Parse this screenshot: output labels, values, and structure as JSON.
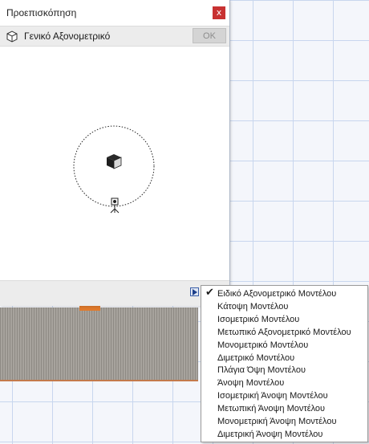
{
  "dialog": {
    "title": "Προεπισκόπηση",
    "close_label": "x",
    "view_icon": "isometric-box-icon",
    "view_name": "Γενικό Αξονομετρικό",
    "ok_label": "OK"
  },
  "preview": {
    "cube_icon": "cube-icon",
    "camera_icon": "camera-icon"
  },
  "menu": {
    "arrow_icon": "triangle-right-icon",
    "items": [
      {
        "label": "Ειδικό Αξονομετρικό Μοντέλου",
        "checked": true
      },
      {
        "label": "Κάτοψη Μοντέλου",
        "checked": false
      },
      {
        "label": "Ισομετρικό Μοντέλου",
        "checked": false
      },
      {
        "label": "Μετωπικό Αξονομετρικό Μοντέλου",
        "checked": false
      },
      {
        "label": "Μονομετρικό Μοντέλου",
        "checked": false
      },
      {
        "label": "Διμετρικό Μοντέλου",
        "checked": false
      },
      {
        "label": "Πλάγια Όψη Μοντέλου",
        "checked": false
      },
      {
        "label": "Άνοψη Μοντέλου",
        "checked": false
      },
      {
        "label": "Ισομετρική Άνοψη Μοντέλου",
        "checked": false
      },
      {
        "label": "Μετωπική Άνοψη Μοντέλου",
        "checked": false
      },
      {
        "label": "Μονομετρική Άνοψη Μοντέλου",
        "checked": false
      },
      {
        "label": "Διμετρική Άνοψη Μοντέλου",
        "checked": false
      }
    ]
  },
  "colors": {
    "close": "#c83232",
    "marker": "#e07a2c",
    "grid": "#c8d6ee"
  }
}
